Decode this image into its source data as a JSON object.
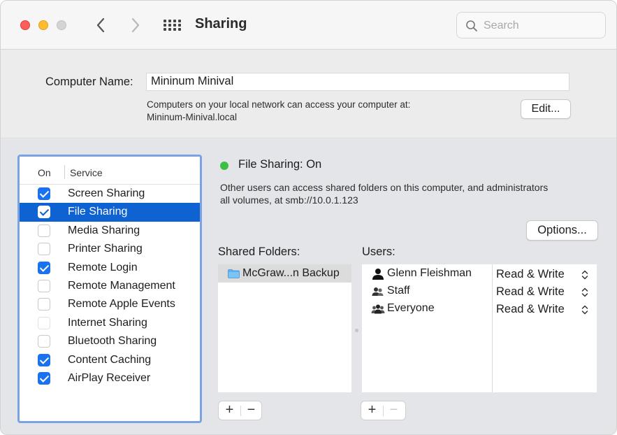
{
  "window": {
    "title": "Sharing"
  },
  "toolbar": {
    "search_placeholder": "Search",
    "icons": [
      "back-chevron-icon",
      "forward-chevron-icon",
      "show-all-grid-icon",
      "search-icon"
    ]
  },
  "computer": {
    "label": "Computer Name:",
    "name": "Mininum Minival",
    "help_line1": "Computers on your local network can access your computer at:",
    "help_line2": "Mininum-Minival.local",
    "edit_label": "Edit..."
  },
  "services": {
    "header_on": "On",
    "header_service": "Service",
    "items": [
      {
        "label": "Screen Sharing",
        "checked": true,
        "selected": false
      },
      {
        "label": "File Sharing",
        "checked": true,
        "selected": true
      },
      {
        "label": "Media Sharing",
        "checked": false,
        "selected": false
      },
      {
        "label": "Printer Sharing",
        "checked": false,
        "selected": false
      },
      {
        "label": "Remote Login",
        "checked": true,
        "selected": false
      },
      {
        "label": "Remote Management",
        "checked": false,
        "selected": false
      },
      {
        "label": "Remote Apple Events",
        "checked": false,
        "selected": false
      },
      {
        "label": "Internet Sharing",
        "checked": false,
        "selected": false
      },
      {
        "label": "Bluetooth Sharing",
        "checked": false,
        "selected": false
      },
      {
        "label": "Content Caching",
        "checked": true,
        "selected": false
      },
      {
        "label": "AirPlay Receiver",
        "checked": true,
        "selected": false
      }
    ]
  },
  "detail": {
    "status": "File Sharing: On",
    "status_color": "#3bbf47",
    "description_line1": "Other users can access shared folders on this computer, and administrators",
    "description_line2": "all volumes, at smb://10.0.1.123",
    "options_label": "Options...",
    "shared_folders_label": "Shared Folders:",
    "users_label": "Users:",
    "folders": [
      {
        "name": "McGraw...n Backup",
        "icon": "folder-icon"
      }
    ],
    "users": [
      {
        "name": "Glenn Fleishman",
        "icon": "single-user-icon",
        "permission": "Read & Write"
      },
      {
        "name": "Staff",
        "icon": "group-icon",
        "permission": "Read & Write"
      },
      {
        "name": "Everyone",
        "icon": "everyone-icon",
        "permission": "Read & Write"
      }
    ],
    "add_label": "+",
    "remove_label": "−"
  },
  "colors": {
    "accent": "#0e62d2",
    "checkbox": "#1a72f0",
    "panel_focus": "#7ba3e2"
  }
}
